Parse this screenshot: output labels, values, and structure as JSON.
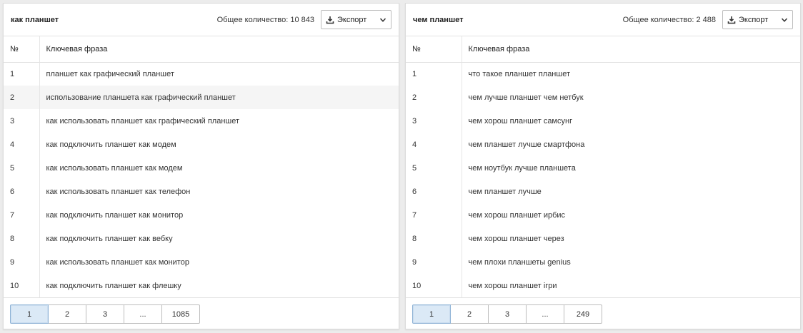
{
  "panels": [
    {
      "title": "как планшет",
      "total_label": "Общее количество: 10 843",
      "export_label": "Экспорт",
      "headers": {
        "num": "№",
        "phrase": "Ключевая фраза"
      },
      "rows": [
        {
          "num": "1",
          "phrase": "планшет как графический планшет"
        },
        {
          "num": "2",
          "phrase": "использование планшета как графический планшет"
        },
        {
          "num": "3",
          "phrase": "как использовать планшет как графический планшет"
        },
        {
          "num": "4",
          "phrase": "как подключить планшет как модем"
        },
        {
          "num": "5",
          "phrase": "как использовать планшет как модем"
        },
        {
          "num": "6",
          "phrase": "как использовать планшет как телефон"
        },
        {
          "num": "7",
          "phrase": "как подключить планшет как монитор"
        },
        {
          "num": "8",
          "phrase": "как подключить планшет как вебку"
        },
        {
          "num": "9",
          "phrase": "как использовать планшет как монитор"
        },
        {
          "num": "10",
          "phrase": "как подключить планшет как флешку"
        }
      ],
      "pages": [
        "1",
        "2",
        "3",
        "...",
        "1085"
      ]
    },
    {
      "title": "чем планшет",
      "total_label": "Общее количество: 2 488",
      "export_label": "Экспорт",
      "headers": {
        "num": "№",
        "phrase": "Ключевая фраза"
      },
      "rows": [
        {
          "num": "1",
          "phrase": "что такое планшет планшет"
        },
        {
          "num": "2",
          "phrase": "чем лучше планшет чем нетбук"
        },
        {
          "num": "3",
          "phrase": "чем хорош планшет самсунг"
        },
        {
          "num": "4",
          "phrase": "чем планшет лучше смартфона"
        },
        {
          "num": "5",
          "phrase": "чем ноутбук лучше планшета"
        },
        {
          "num": "6",
          "phrase": "чем планшет лучше"
        },
        {
          "num": "7",
          "phrase": "чем хорош планшет ирбис"
        },
        {
          "num": "8",
          "phrase": "чем хорош планшет через"
        },
        {
          "num": "9",
          "phrase": "чем плохи планшеты genius"
        },
        {
          "num": "10",
          "phrase": "чем хорош планшет ігри"
        }
      ],
      "pages": [
        "1",
        "2",
        "3",
        "...",
        "249"
      ]
    }
  ],
  "icons": {
    "export": "download-icon",
    "dropdown": "chevron-down-icon"
  },
  "colors": {
    "active_page_bg": "#dbe9f6",
    "row_hover_bg": "#f5f5f5"
  }
}
